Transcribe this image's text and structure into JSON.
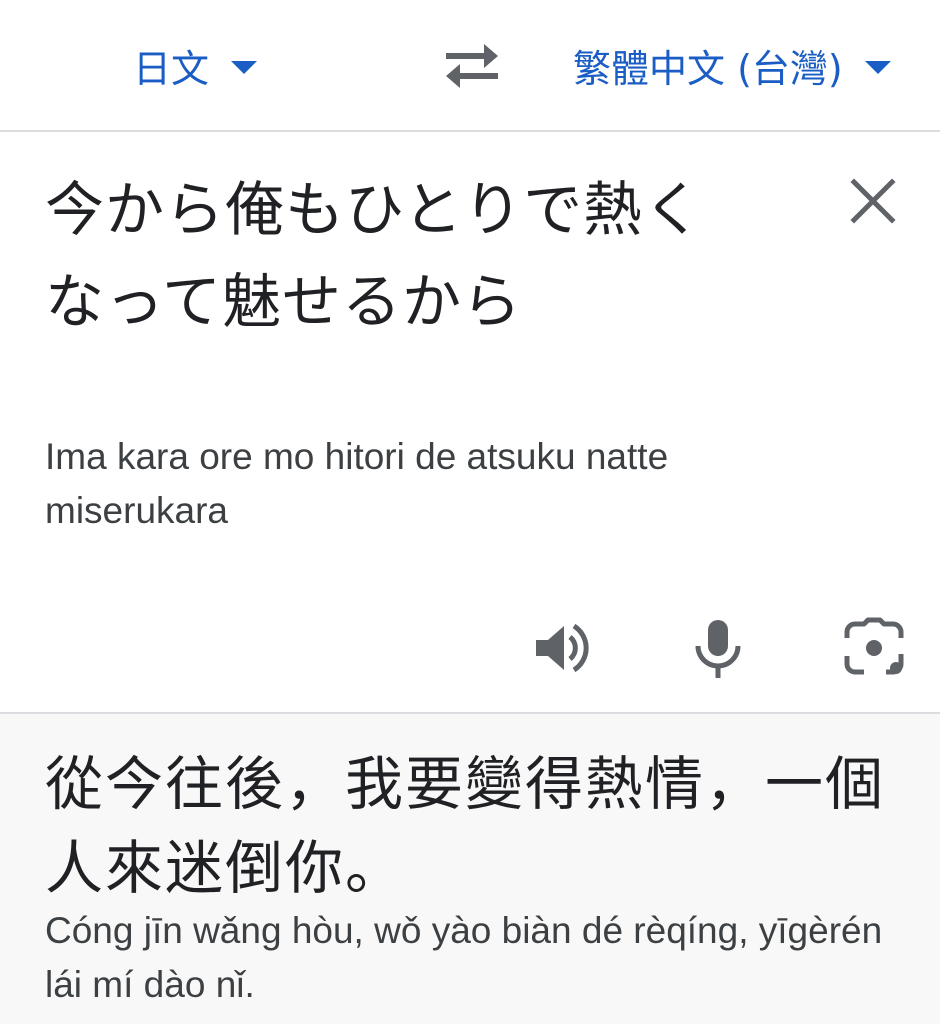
{
  "language_bar": {
    "source_language": "日文",
    "target_language": "繁體中文 (台灣)",
    "accent_color": "#1a5dc4",
    "swap_icon": "swap-arrows-icon",
    "dropdown_icon": "caret-down-icon"
  },
  "source": {
    "text": "今から俺もひとりで熱くなって魅せるから",
    "transliteration": "Ima kara ore mo hitori de atsuku natte miserukara",
    "clear_icon": "close-icon",
    "tools": [
      {
        "icon": "speaker-icon"
      },
      {
        "icon": "microphone-icon"
      },
      {
        "icon": "camera-icon"
      }
    ]
  },
  "translation": {
    "text": "從今往後，我要變得熱情，一個人來迷倒你。",
    "transliteration": "Cóng jīn wǎng hòu, wǒ yào biàn dé rèqíng, yīgèrén lái mí dào nǐ."
  }
}
